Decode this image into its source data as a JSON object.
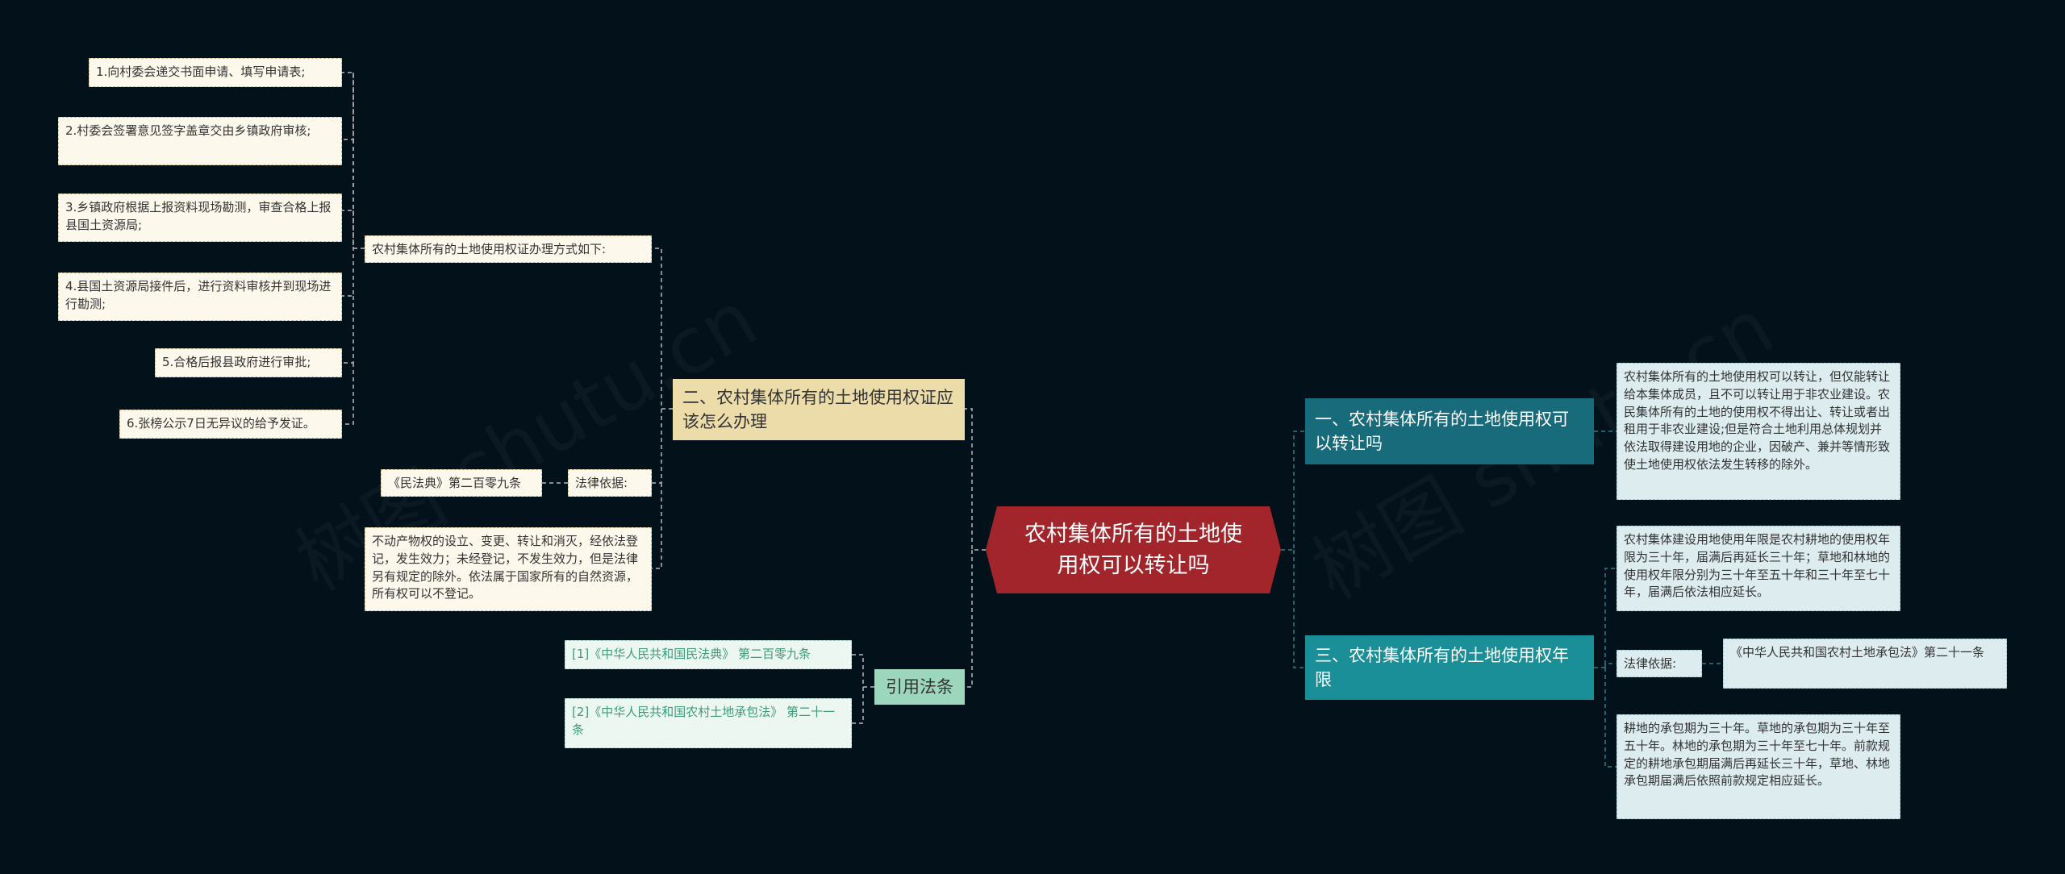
{
  "center": {
    "title": "农村集体所有的土地使用权可以转让吗"
  },
  "left": {
    "branch_b": {
      "title": "二、农村集体所有的土地使用权证应该怎么办理",
      "procedure": {
        "label": "农村集体所有的土地使用权证办理方式如下:",
        "steps": [
          "1.向村委会递交书面申请、填写申请表;",
          "2.村委会签署意见签字盖章交由乡镇政府审核;",
          "3.乡镇政府根据上报资料现场勘测，审查合格上报县国土资源局;",
          "4.县国土资源局接件后，进行资料审核并到现场进行勘测;",
          "5.合格后报县政府进行审批;",
          "6.张榜公示7日无异议的给予发证。"
        ]
      },
      "legal_basis": {
        "label": "法律依据:",
        "source": "《民法典》第二百零九条"
      },
      "legal_text": "不动产物权的设立、变更、转让和消灭，经依法登记，发生效力；未经登记，不发生效力，但是法律另有规定的除外。依法属于国家所有的自然资源，所有权可以不登记。"
    },
    "citations": {
      "title": "引用法条",
      "items": [
        "[1]《中华人民共和国民法典》 第二百零九条",
        "[2]《中华人民共和国农村土地承包法》 第二十一条"
      ]
    }
  },
  "right": {
    "branch_a": {
      "title": "一、农村集体所有的土地使用权可以转让吗",
      "text": "农村集体所有的土地使用权可以转让，但仅能转让给本集体成员，且不可以转让用于非农业建设。农民集体所有的土地的使用权不得出让、转让或者出租用于非农业建设;但是符合土地利用总体规划并依法取得建设用地的企业，因破产、兼并等情形致使土地使用权依法发生转移的除外。"
    },
    "branch_c": {
      "title": "三、农村集体所有的土地使用权年限",
      "text1": "农村集体建设用地使用年限是农村耕地的使用权年限为三十年，届满后再延长三十年；草地和林地的使用权年限分别为三十年至五十年和三十年至七十年，届满后依法相应延长。",
      "legal_label": "法律依据:",
      "legal_source": "《中华人民共和国农村土地承包法》第二十一条",
      "text2": "耕地的承包期为三十年。草地的承包期为三十年至五十年。林地的承包期为三十年至七十年。前款规定的耕地承包期届满后再延长三十年，草地、林地承包期届满后依照前款规定相应延长。"
    }
  },
  "watermark": "树图 shutu.cn",
  "colors": {
    "background": "#03111a",
    "center": "#a1252a",
    "yellow": "#ecdcaa",
    "teal_dark": "#176b7a",
    "teal": "#1b8f97",
    "mint": "#9bd6bd"
  }
}
